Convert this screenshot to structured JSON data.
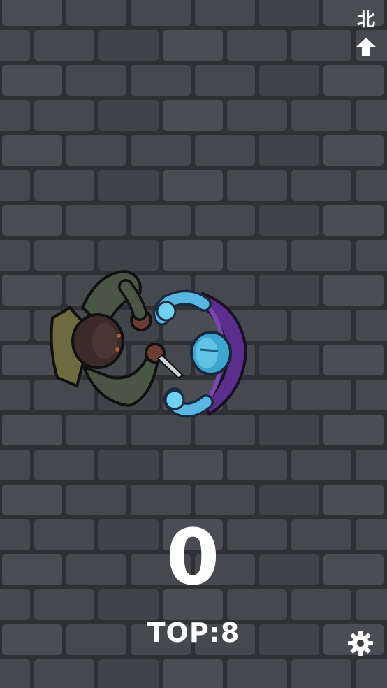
{
  "hud": {
    "compass_label": "北",
    "compass_icon": "arrow-up-icon",
    "score": "0",
    "top_score": "TOP:8",
    "settings_icon": "gear-icon"
  },
  "colors": {
    "wall_base": "#3b3d40",
    "brick": "#45484c",
    "mortar": "#2e3033",
    "hud_text": "#ffffff"
  }
}
